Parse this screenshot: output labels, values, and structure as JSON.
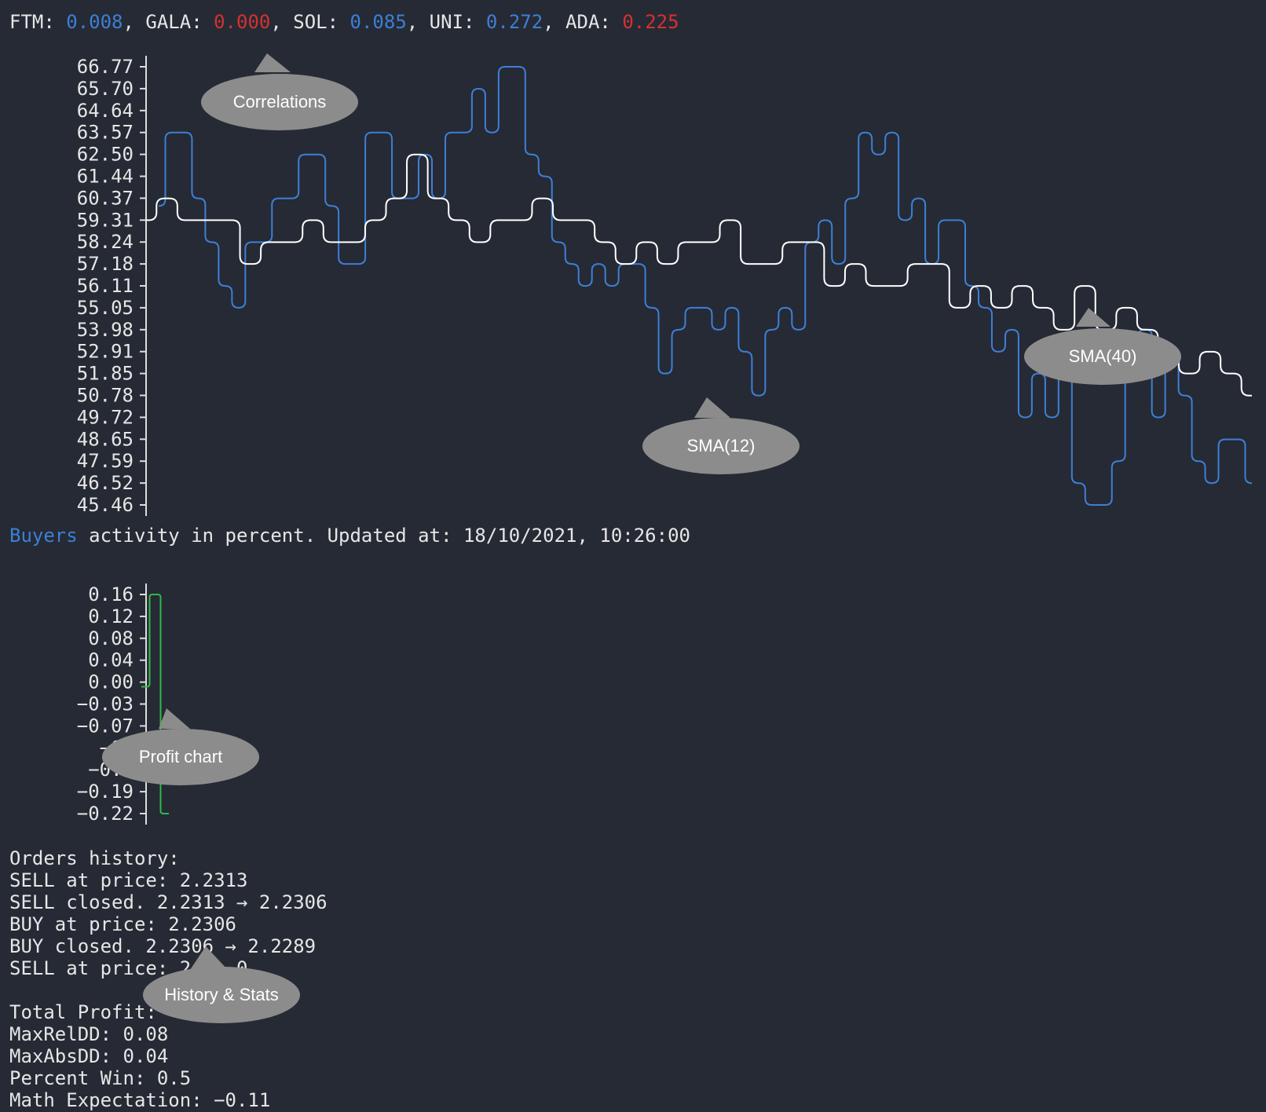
{
  "ticker": [
    {
      "sym": "FTM",
      "val": "0.008",
      "color": "blue"
    },
    {
      "sym": "GALA",
      "val": "0.000",
      "color": "red"
    },
    {
      "sym": "SOL",
      "val": "0.085",
      "color": "blue"
    },
    {
      "sym": "UNI",
      "val": "0.272",
      "color": "blue"
    },
    {
      "sym": "ADA",
      "val": "0.225",
      "color": "red"
    }
  ],
  "colors": {
    "background": "#262a34",
    "price": "#3d7fd8",
    "sma": "#ffffff",
    "profit": "#2fb84a",
    "callout": "#8c8c8c",
    "text": "#e6e6e6",
    "negative": "#d63131"
  },
  "price_chart": {
    "ticks": [
      "66.77",
      "65.70",
      "64.64",
      "63.57",
      "62.50",
      "61.44",
      "60.37",
      "59.31",
      "58.24",
      "57.18",
      "56.11",
      "55.05",
      "53.98",
      "52.91",
      "51.85",
      "50.78",
      "49.72",
      "48.65",
      "47.59",
      "46.52",
      "45.46"
    ],
    "ymin": 45.46,
    "ymax": 66.77
  },
  "buyers": {
    "highlight": "Buyers",
    "text": " activity in percent. Updated at: 18/10/2021, 10:26:00"
  },
  "profit_chart": {
    "ticks": [
      "0.16",
      "0.12",
      "0.08",
      "0.04",
      "0.00",
      "−0.03",
      "−0.07",
      "−0.",
      "−0.1",
      "−0.19",
      "−0.22"
    ],
    "ymin": -0.22,
    "ymax": 0.16
  },
  "history": {
    "title": "Orders history:",
    "lines": [
      "SELL at price: 2.2313",
      "SELL closed. 2.2313 → 2.2306",
      "BUY at price: 2.2306",
      "BUY closed. 2.2306 → 2.2289",
      "SELL at price: 2.  .0"
    ]
  },
  "stats": [
    "Total Profit:",
    "MaxRelDD: 0.08",
    "MaxAbsDD: 0.04",
    "Percent Win: 0.5",
    "Math Expectation: −0.11"
  ],
  "callouts": {
    "correlations": "Correlations",
    "sma12": "SMA(12)",
    "sma40": "SMA(40)",
    "profit": "Profit chart",
    "history": "History & Stats"
  },
  "chart_data": [
    {
      "type": "line",
      "title": "",
      "ylim": [
        45.46,
        66.77
      ],
      "grid": false,
      "series": [
        {
          "name": "",
          "values": [
            60.0,
            63.57,
            63.57,
            60.37,
            58.24,
            56.11,
            55.05,
            58.24,
            58.24,
            60.37,
            60.37,
            62.5,
            62.5,
            60.0,
            57.18,
            57.18,
            63.57,
            63.57,
            60.37,
            60.37,
            62.5,
            60.37,
            63.57,
            63.57,
            65.7,
            63.57,
            66.77,
            66.77,
            62.5,
            61.44,
            58.24,
            57.18,
            56.11,
            57.18,
            56.11,
            57.18,
            57.18,
            55.05,
            51.85,
            53.98,
            55.05,
            55.05,
            53.98,
            55.05,
            52.91,
            50.78,
            53.98,
            55.05,
            53.98,
            58.24,
            59.31,
            57.18,
            60.37,
            63.57,
            62.5,
            63.57,
            59.31,
            60.37,
            57.18,
            59.31,
            59.31,
            56.11,
            55.05,
            52.91,
            53.98,
            49.72,
            51.85,
            49.72,
            51.85,
            46.52,
            45.46,
            45.46,
            47.59,
            51.85,
            54.0,
            49.72,
            52.91,
            50.78,
            47.59,
            46.52,
            48.65,
            48.65,
            46.52
          ]
        },
        {
          "name": "",
          "values": [
            59.31,
            60.37,
            59.31,
            59.31,
            59.31,
            57.18,
            58.24,
            58.24,
            59.31,
            58.24,
            58.24,
            59.31,
            60.37,
            62.5,
            60.37,
            59.31,
            58.24,
            59.31,
            59.31,
            60.37,
            59.31,
            59.31,
            58.24,
            57.18,
            58.24,
            57.18,
            58.24,
            58.24,
            59.31,
            57.18,
            57.18,
            58.24,
            58.24,
            56.11,
            57.18,
            56.11,
            56.11,
            57.18,
            57.18,
            55.05,
            56.11,
            55.05,
            56.11,
            55.05,
            53.98,
            56.11,
            53.98,
            55.05,
            53.98,
            52.91,
            51.85,
            52.91,
            51.85,
            50.78
          ]
        }
      ]
    },
    {
      "type": "line",
      "title": "",
      "ylim": [
        -0.22,
        0.16
      ],
      "grid": false,
      "series": [
        {
          "name": "",
          "values": [
            0.0,
            0.0,
            0.16,
            0.16,
            -0.22,
            -0.22
          ]
        }
      ]
    }
  ]
}
